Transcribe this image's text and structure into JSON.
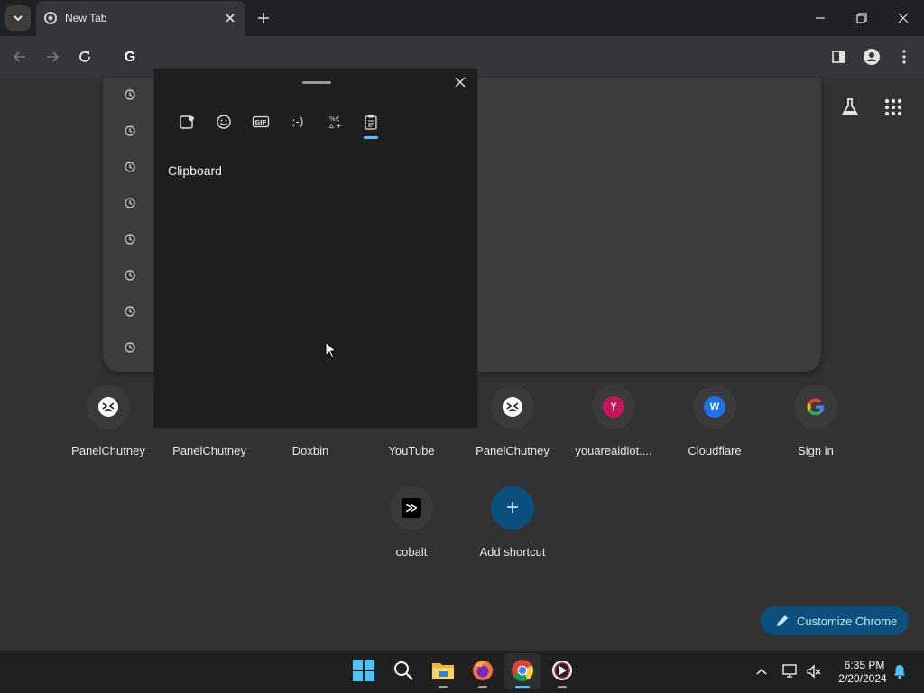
{
  "browser": {
    "tab_title": "New Tab",
    "omnibox_icon": "G"
  },
  "emoji_panel": {
    "tabs": [
      "favorites-icon",
      "emoji-icon",
      "gif-icon",
      "kaomoji-icon",
      "symbols-icon",
      "clipboard-icon"
    ],
    "active_tab": "clipboard-icon",
    "heading": "Clipboard"
  },
  "shortcuts": [
    {
      "label": "PanelChutney",
      "icon": "panelchutney-icon"
    },
    {
      "label": "PanelChutney",
      "icon": "panelchutney-icon"
    },
    {
      "label": "Doxbin",
      "icon": "doxbin-icon"
    },
    {
      "label": "YouTube",
      "icon": "youtube-icon"
    },
    {
      "label": "PanelChutney",
      "icon": "panelchutney-icon"
    },
    {
      "label": "youareaidiot....",
      "icon": "y-letter-icon",
      "letter": "Y"
    },
    {
      "label": "Cloudflare",
      "icon": "w-letter-icon",
      "letter": "W"
    },
    {
      "label": "Sign in",
      "icon": "google-icon"
    },
    {
      "label": "cobalt",
      "icon": "cobalt-icon",
      "glyph": "≫"
    },
    {
      "label": "Add shortcut",
      "icon": "plus-icon",
      "glyph": "+"
    }
  ],
  "customize": {
    "label": "Customize Chrome"
  },
  "taskbar": {
    "time": "6:35 PM",
    "date": "2/20/2024"
  },
  "colors": {
    "accent": "#4cc2ff",
    "letter_y": "#c2185b",
    "letter_w": "#1a73e8",
    "customize_bg": "#0b4f7c"
  }
}
